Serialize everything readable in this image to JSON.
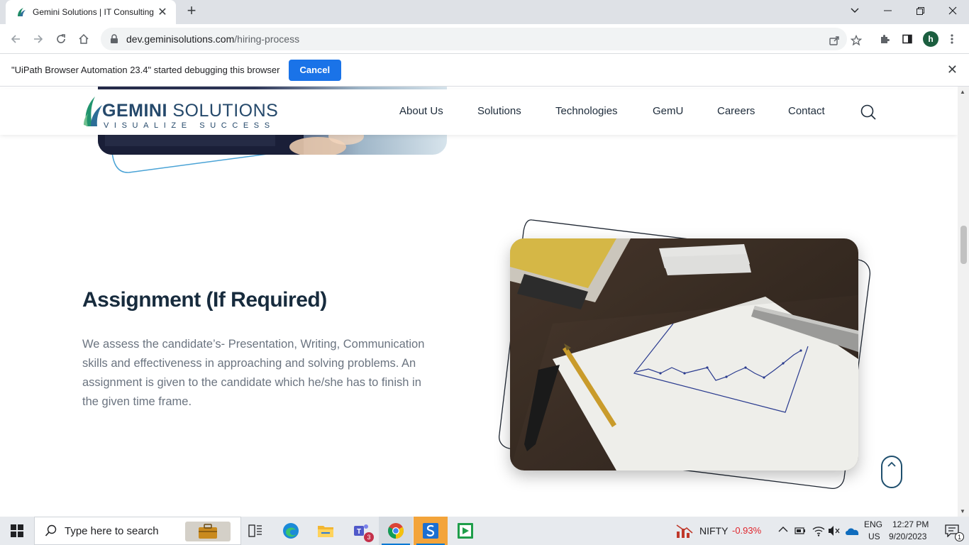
{
  "browser": {
    "tab_title": "Gemini Solutions | IT Consulting",
    "url_host": "dev.geminisolutions.com",
    "url_path": "/hiring-process",
    "profile_initial": "h"
  },
  "infobar": {
    "message": "\"UiPath Browser Automation 23.4\" started debugging this browser",
    "cancel_label": "Cancel"
  },
  "site": {
    "logo_word_bold": "GEMINI",
    "logo_word_light": " SOLUTIONS",
    "logo_tagline": "VISUALIZE SUCCESS",
    "nav": [
      "About Us",
      "Solutions",
      "Technologies",
      "GemU",
      "Careers",
      "Contact"
    ]
  },
  "section": {
    "title": "Assignment (If Required)",
    "body": "We assess the candidate’s- Presentation, Writing, Communication skills and effectiveness in approaching and solving problems. An assignment is given to the candidate which he/she has to finish in the given time frame."
  },
  "taskbar": {
    "search_placeholder": "Type here to search",
    "teams_badge": "3",
    "stock_name": "NIFTY",
    "stock_change": "-0.93%",
    "lang_top": "ENG",
    "lang_bottom": "US",
    "time": "12:27 PM",
    "date": "9/20/2023",
    "notification_count": "1"
  },
  "colors": {
    "accent_blue": "#1a73e8",
    "brand_navy": "#25496b",
    "stock_down": "#e0262d"
  }
}
